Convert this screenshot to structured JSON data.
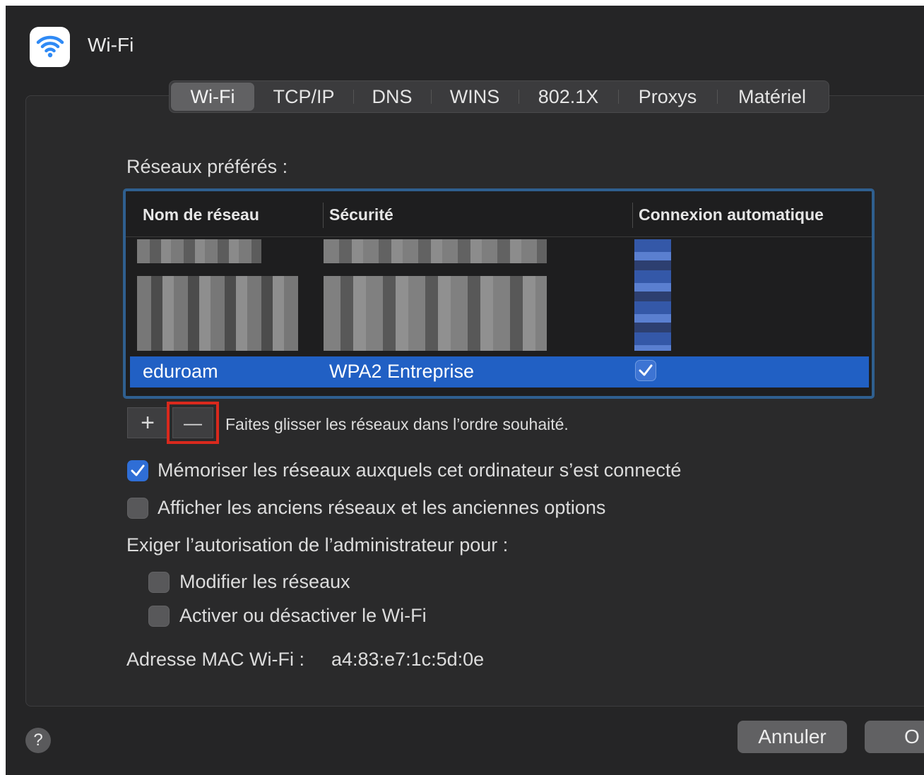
{
  "window": {
    "title": "Wi-Fi",
    "icon": "wifi-icon"
  },
  "tabs": [
    {
      "label": "Wi-Fi",
      "active": true
    },
    {
      "label": "TCP/IP",
      "active": false
    },
    {
      "label": "DNS",
      "active": false
    },
    {
      "label": "WINS",
      "active": false
    },
    {
      "label": "802.1X",
      "active": false
    },
    {
      "label": "Proxys",
      "active": false
    },
    {
      "label": "Matériel",
      "active": false
    }
  ],
  "preferred_networks": {
    "heading": "Réseaux préférés :",
    "columns": [
      "Nom de réseau",
      "Sécurité",
      "Connexion automatique"
    ],
    "selected_row": {
      "name": "eduroam",
      "security": "WPA2 Entreprise",
      "auto_connect": true
    },
    "hint": "Faites glisser les réseaux dans l’ordre souhaité.",
    "add_label": "+",
    "remove_label": "—"
  },
  "options": {
    "remember": {
      "label": "Mémoriser les réseaux auxquels cet ordinateur s’est connecté",
      "checked": true
    },
    "show_legacy": {
      "label": "Afficher les anciens réseaux et les anciennes options",
      "checked": false
    },
    "admin_heading": "Exiger l’autorisation de l’administrateur pour :",
    "modify_networks": {
      "label": "Modifier les réseaux",
      "checked": false
    },
    "toggle_wifi": {
      "label": "Activer ou désactiver le Wi-Fi",
      "checked": false
    }
  },
  "mac": {
    "label": "Adresse MAC Wi-Fi :",
    "value": "a4:83:e7:1c:5d:0e"
  },
  "footer": {
    "help_label": "?",
    "cancel_label": "Annuler",
    "ok_label": "O"
  },
  "colors": {
    "accent": "#2160c4",
    "highlight_box": "#d9291d",
    "background": "#252526"
  }
}
